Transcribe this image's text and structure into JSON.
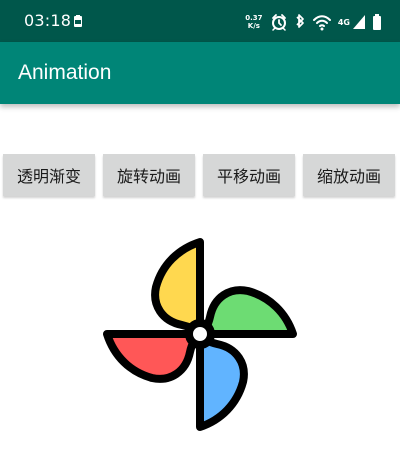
{
  "status_bar": {
    "time": "03:18",
    "speed_value": "0.37",
    "speed_unit": "K/s",
    "network_label": "4G",
    "icons": [
      "sim-storage-icon",
      "network-speed-icon",
      "alarm-clock-icon",
      "bluetooth-icon",
      "wifi-icon",
      "signal-icon",
      "battery-icon"
    ]
  },
  "app_bar": {
    "title": "Animation",
    "color": "#008577",
    "status_color": "#00574b"
  },
  "buttons": [
    {
      "label": "透明渐变"
    },
    {
      "label": "旋转动画"
    },
    {
      "label": "平移动画"
    },
    {
      "label": "缩放动画"
    }
  ],
  "windmill": {
    "icon": "windmill-icon",
    "blade_colors": [
      "#ffd84f",
      "#6ddc73",
      "#ff5757",
      "#61b4ff"
    ],
    "outline_color": "#000000",
    "center_color": "#ffffff"
  }
}
